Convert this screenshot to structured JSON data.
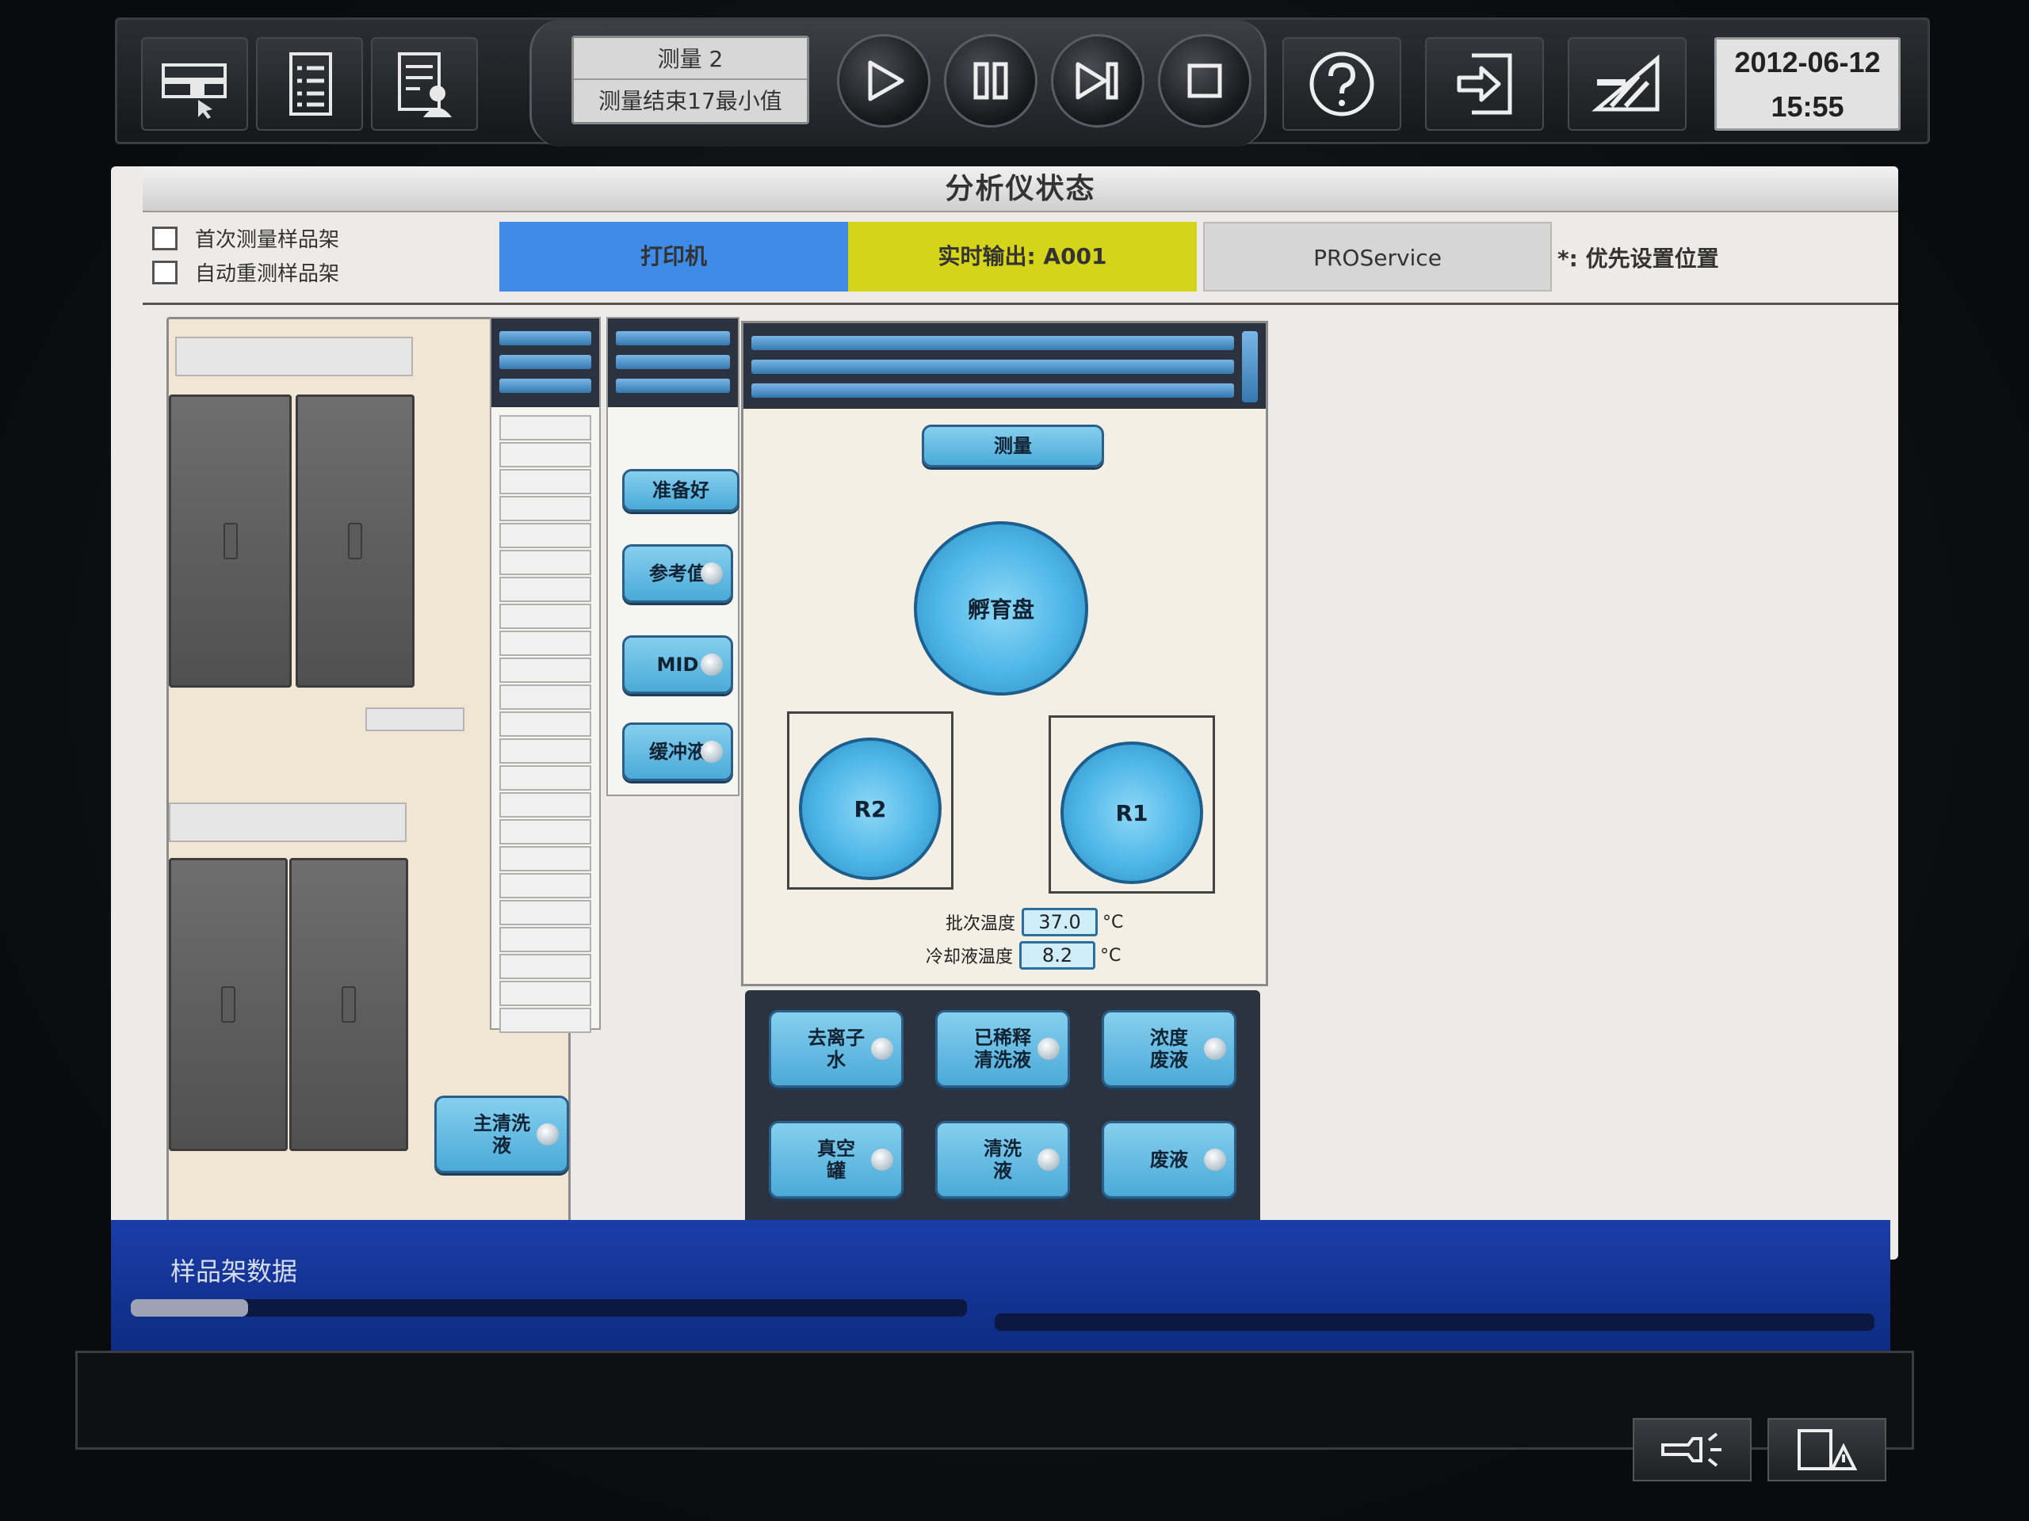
{
  "toolbar": {
    "measurement_name": "测量 2",
    "measurement_status": "测量结束17最小值",
    "date": "2012-06-12",
    "time": "15:55"
  },
  "window": {
    "title": "分析仪状态"
  },
  "options": {
    "first_measure_rack": "首次测量样品架",
    "auto_remeasure_rack": "自动重测样品架"
  },
  "status_tiles": {
    "printer": "打印机",
    "realtime_output": "实时输出: A001",
    "proservice": "PROService",
    "priority_note": "*: 优先设置位置"
  },
  "station_buttons": {
    "ready": "准备好",
    "reference": "参考值",
    "mid": "MID",
    "buffer": "缓冲液"
  },
  "center": {
    "measure_button": "测量",
    "incubation_disk": "孵育盘",
    "r2": "R2",
    "r1": "R1",
    "batch_temp_label": "批次温度",
    "batch_temp_value": "37.0",
    "coolant_temp_label": "冷却液温度",
    "coolant_temp_value": "8.2",
    "unit": "°C"
  },
  "liquids": {
    "main_wash": "主清洗\n液",
    "deionized_water": "去离子\n水",
    "diluted_wash": "已稀释\n清洗液",
    "concentrated_waste": "浓度\n废液",
    "vacuum_tank": "真空\n罐",
    "wash_liquid": "清洗\n液",
    "waste": "废液"
  },
  "rack_data": {
    "title": "样品架数据",
    "progress": 0.14
  },
  "colors": {
    "printer_tile": "#3e8be8",
    "output_tile": "#d4d41a",
    "proservice_tile": "#d6d6d6",
    "accent_blue": "#4cb6e8",
    "status_bar_blue": "#1a3da8"
  },
  "icons": {
    "rack_overview": "rack-overview-icon",
    "worklist": "worklist-icon",
    "patient_report": "patient-report-icon",
    "play": "play-icon",
    "pause": "pause-icon",
    "skip": "skip-icon",
    "stop": "stop-icon",
    "help": "help-icon",
    "logout": "logout-icon",
    "reagent": "reagent-icon",
    "alarm": "alarm-icon",
    "warning": "warning-icon"
  }
}
